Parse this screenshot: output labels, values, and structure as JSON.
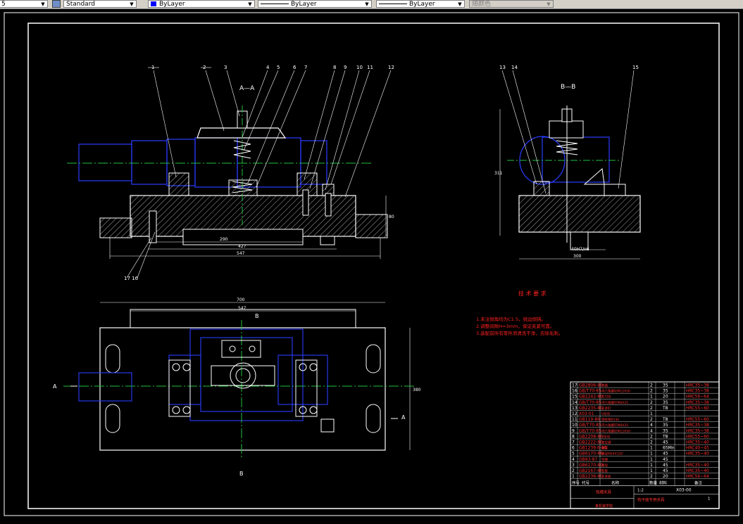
{
  "toolbar": {
    "left_fragment": "5",
    "text_style": "Standard",
    "layer": "ByLayer",
    "layer_color": "#0000ff",
    "linetype": "ByLayer",
    "lineweight": "ByLayer",
    "plot_color": "随颜色"
  },
  "drawing": {
    "section_aa": "A—A",
    "section_bb": "B—B",
    "callouts_aa": [
      "1",
      "2",
      "3",
      "4",
      "5",
      "6",
      "7",
      "8",
      "9",
      "10",
      "11",
      "12"
    ],
    "callouts_bottom": "17 16",
    "callouts_bb": [
      "13",
      "14",
      "15"
    ],
    "dims": {
      "d290": "290",
      "d427": "427",
      "d547": "547",
      "d700": "700",
      "d547b": "547",
      "d300": "300",
      "d311": "311",
      "d80": "80",
      "fit": "40H7/n6",
      "vert_right": "380"
    },
    "markers": {
      "a": "A",
      "b": "B"
    },
    "tech_title": "技 术 要 求",
    "tech_notes": [
      "1.未注倒角均为C1.5，锐边倒钝。",
      "2.调整间隙H=3mm，保证夹紧可靠。",
      "3.装配前所有零件须清洗干净，去除毛刺。"
    ]
  },
  "bom": {
    "rows": [
      {
        "no": "17",
        "code": "GB2806-80",
        "name": "垫圈",
        "qty": "2",
        "mat": "35",
        "note": "HRC35~38"
      },
      {
        "no": "16",
        "code": "GB/T70-85",
        "name": "内六角螺钉M12X50",
        "qty": "2",
        "mat": "35",
        "note": "HRC35~38"
      },
      {
        "no": "15",
        "code": "GB2242-80",
        "name": "对刀块",
        "qty": "1",
        "mat": "20",
        "note": "HRC56~64"
      },
      {
        "no": "14",
        "code": "GB/T70-85",
        "name": "内六角螺钉M8X25",
        "qty": "2",
        "mat": "35",
        "note": "HRC35~38"
      },
      {
        "no": "13",
        "code": "GB2235-80",
        "name": "支承钉",
        "qty": "2",
        "mat": "T8",
        "note": "HRC55~60"
      },
      {
        "no": "12",
        "code": "X03-01",
        "name": "V形块",
        "qty": "1",
        "mat": "",
        "note": ""
      },
      {
        "no": "11",
        "code": "GB119-86",
        "name": "圆柱销6X30",
        "qty": "2",
        "mat": "T8",
        "note": "HRC55~60"
      },
      {
        "no": "10",
        "code": "GB/T70-85",
        "name": "内六角螺钉M8X25",
        "qty": "4",
        "mat": "35",
        "note": "HRC35~38"
      },
      {
        "no": "9",
        "code": "GB/T70-85",
        "name": "内六角螺钉M12X50",
        "qty": "4",
        "mat": "35",
        "note": "HRC35~38"
      },
      {
        "no": "8",
        "code": "GB2208-80",
        "name": "V形块",
        "qty": "2",
        "mat": "T8",
        "note": "HRC55~60"
      },
      {
        "no": "7",
        "code": "GB2222-80",
        "name": "定位键",
        "qty": "2",
        "mat": "45",
        "note": "HRC35~40"
      },
      {
        "no": "6",
        "code": "GB1239.6-80",
        "name": "弹簧",
        "qty": "1",
        "mat": "65Mn",
        "note": "HRC40~45"
      },
      {
        "no": "5",
        "code": "GB6170-86",
        "name": "螺母M24X120",
        "qty": "1",
        "mat": "45",
        "note": "HRC35~40"
      },
      {
        "no": "4",
        "code": "GB93-87",
        "name": "垫圈",
        "qty": "1",
        "mat": "45",
        "note": ""
      },
      {
        "no": "3",
        "code": "GB6170-80",
        "name": "螺母",
        "qty": "1",
        "mat": "45",
        "note": "HRC35~40"
      },
      {
        "no": "2",
        "code": "GB2167-80",
        "name": "压板",
        "qty": "1",
        "mat": "45",
        "note": "HRC35~40"
      },
      {
        "no": "1",
        "code": "GB2236-80",
        "name": "支承板",
        "qty": "2",
        "mat": "20",
        "note": "HRC56~64"
      }
    ],
    "header": [
      "序号",
      "代号",
      "名称",
      "数量",
      "材料",
      "备注"
    ],
    "title_block": {
      "assembly": "铣槽夹具",
      "drawing_no": "X03-00",
      "scale": "1:2",
      "sheet": "1",
      "company": "某机械学院",
      "part_desc": "铣平面专用夹具"
    }
  }
}
